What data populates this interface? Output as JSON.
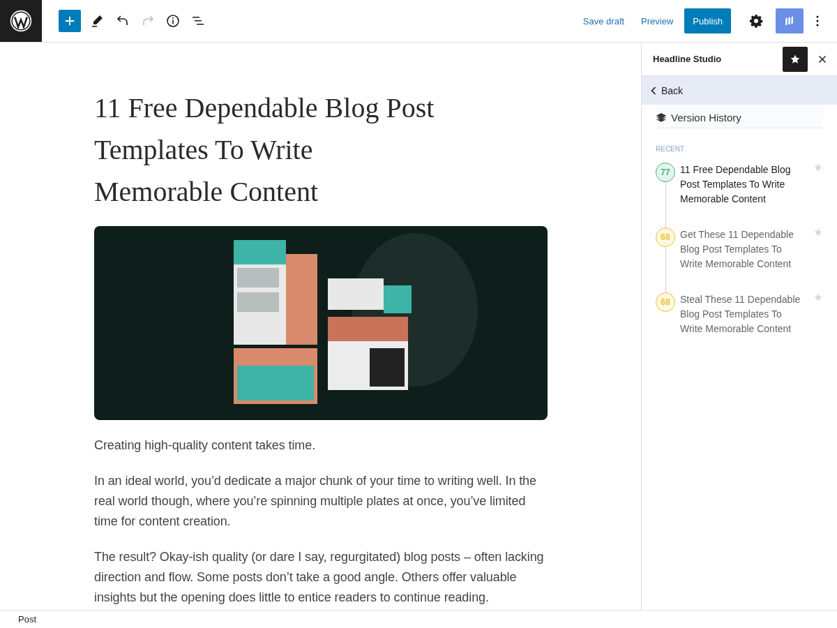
{
  "toolbar": {
    "tools": [
      {
        "kind": "add",
        "disabled": false
      },
      {
        "kind": "edit",
        "disabled": false
      },
      {
        "kind": "undo",
        "disabled": false
      },
      {
        "kind": "redo",
        "disabled": true
      },
      {
        "kind": "info",
        "disabled": false
      },
      {
        "kind": "outline",
        "disabled": false
      }
    ],
    "save_draft": "Save draft",
    "preview": "Preview",
    "publish": "Publish"
  },
  "post": {
    "title": "11 Free Dependable Blog Post Templates To Write Memorable Content",
    "paragraphs": [
      "Creating high-quality content takes time.",
      "In an ideal world, you’d dedicate a major chunk of your time to writing well. In the real world though, where you’re spinning multiple plates at once, you’ve limited time for content creation.",
      "The result? Okay-ish quality (or dare I say, regurgitated) blog posts – often lacking direction and flow. Some posts don’t take a good angle. Others offer valuable insights but the opening does little to entice readers to continue reading."
    ]
  },
  "sidebar": {
    "title": "Headline Studio",
    "back": "Back",
    "section": "Version History",
    "group": "RECENT",
    "versions": [
      {
        "score": "77",
        "color": "#3bb77e",
        "headline": "11 Free Dependable Blog Post Templates To Write Memorable Content",
        "selected": true
      },
      {
        "score": "68",
        "color": "#f2c230",
        "headline": "Get These 11 Dependable Blog Post Templates To Write Memorable Content",
        "selected": false
      },
      {
        "score": "68",
        "color": "#f2c230",
        "headline": "Steal These 11 Dependable Blog Post Templates To Write Memorable Content",
        "selected": false
      }
    ]
  },
  "status_bar": {
    "breadcrumb": "Post"
  }
}
